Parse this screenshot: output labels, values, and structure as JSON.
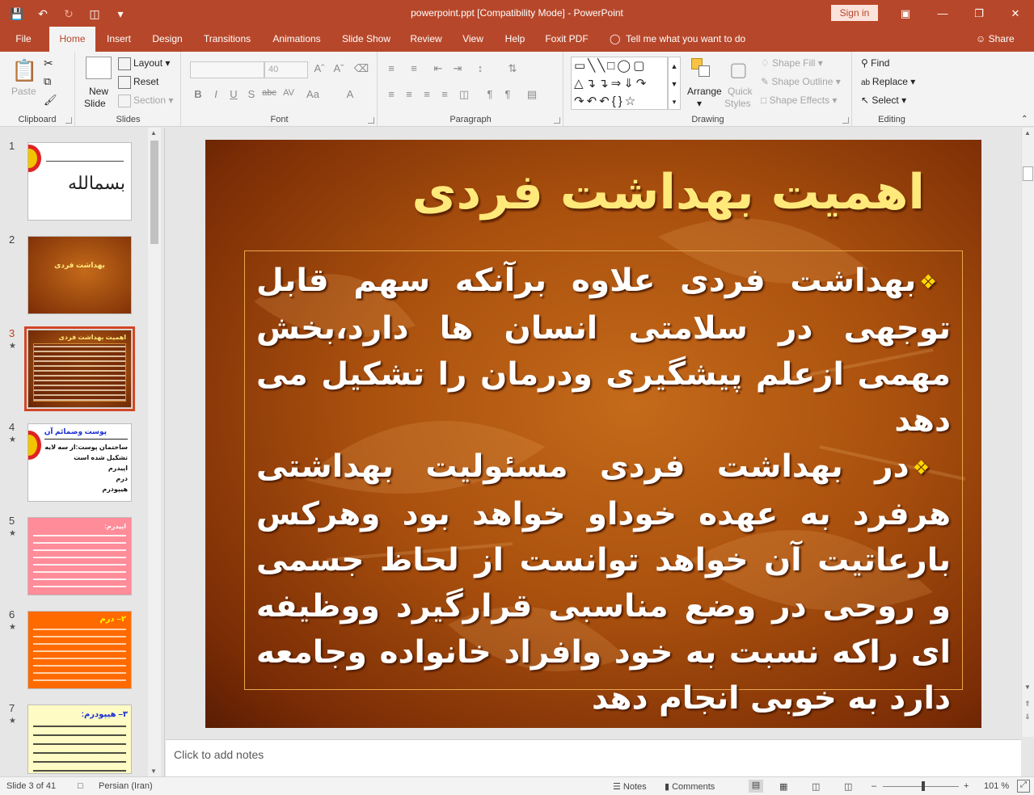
{
  "window": {
    "title": "powerpoint.ppt [Compatibility Mode]  -  PowerPoint",
    "sign_in": "Sign in"
  },
  "menu": {
    "tabs": [
      "File",
      "Home",
      "Insert",
      "Design",
      "Transitions",
      "Animations",
      "Slide Show",
      "Review",
      "View",
      "Help",
      "Foxit PDF"
    ],
    "active": "Home",
    "tell_me": "Tell me what you want to do",
    "share": "Share"
  },
  "ribbon": {
    "clipboard": {
      "label": "Clipboard",
      "paste": "Paste"
    },
    "slides": {
      "label": "Slides",
      "new_slide": "New",
      "new_slide_2": "Slide",
      "layout": "Layout",
      "reset": "Reset",
      "section": "Section"
    },
    "font": {
      "label": "Font",
      "size": "40"
    },
    "paragraph": {
      "label": "Paragraph"
    },
    "drawing": {
      "label": "Drawing",
      "arrange": "Arrange",
      "quick_styles": "Quick",
      "quick_styles_2": "Styles",
      "shape_fill": "Shape Fill",
      "shape_outline": "Shape Outline",
      "shape_effects": "Shape Effects"
    },
    "editing": {
      "label": "Editing",
      "find": "Find",
      "replace": "Replace",
      "select": "Select"
    }
  },
  "thumbnails": [
    {
      "num": "1",
      "star": "",
      "title": ""
    },
    {
      "num": "2",
      "star": "",
      "title": "بهداشت فردی"
    },
    {
      "num": "3",
      "star": "★",
      "title": "اهمیت بهداشت فردی"
    },
    {
      "num": "4",
      "star": "★",
      "title": "پوست وضمائم آن",
      "lines": [
        "ساختمان پوست:از سه لایه",
        "تشکیل شده است",
        "اپیدرم",
        "درم",
        "هیپودرم"
      ]
    },
    {
      "num": "5",
      "star": "★",
      "title": "اپیدرم:"
    },
    {
      "num": "6",
      "star": "★",
      "title": "۲– درم"
    },
    {
      "num": "7",
      "star": "★",
      "title": "۳– هیپودرم:"
    }
  ],
  "slide": {
    "title": "اهمیت بهداشت فردی",
    "paragraphs": [
      "بهداشت فردی علاوه برآنکه سهم قابل توجهی در سلامتی انسان ها دارد،بخش مهمی ازعلم پیشگیری ودرمان را تشکیل می دهد",
      "در بهداشت فردی مسئولیت بهداشتی هرفرد به عهده خوداو خواهد بود وهرکس بارعاتیت آن خواهد توانست از لحاظ جسمی و روحی در وضع مناسبی قرارگیرد ووظیفه ای راکه نسبت به خود وافراد خانواده وجامعه دارد به خوبی انجام دهد"
    ]
  },
  "notes": {
    "placeholder": "Click to add notes"
  },
  "status": {
    "slide_info": "Slide 3 of 41",
    "language": "Persian (Iran)",
    "notes": "Notes",
    "comments": "Comments",
    "zoom": "101 %"
  },
  "colors": {
    "accent": "#b7472a",
    "title_yellow": "#ffe97a"
  }
}
